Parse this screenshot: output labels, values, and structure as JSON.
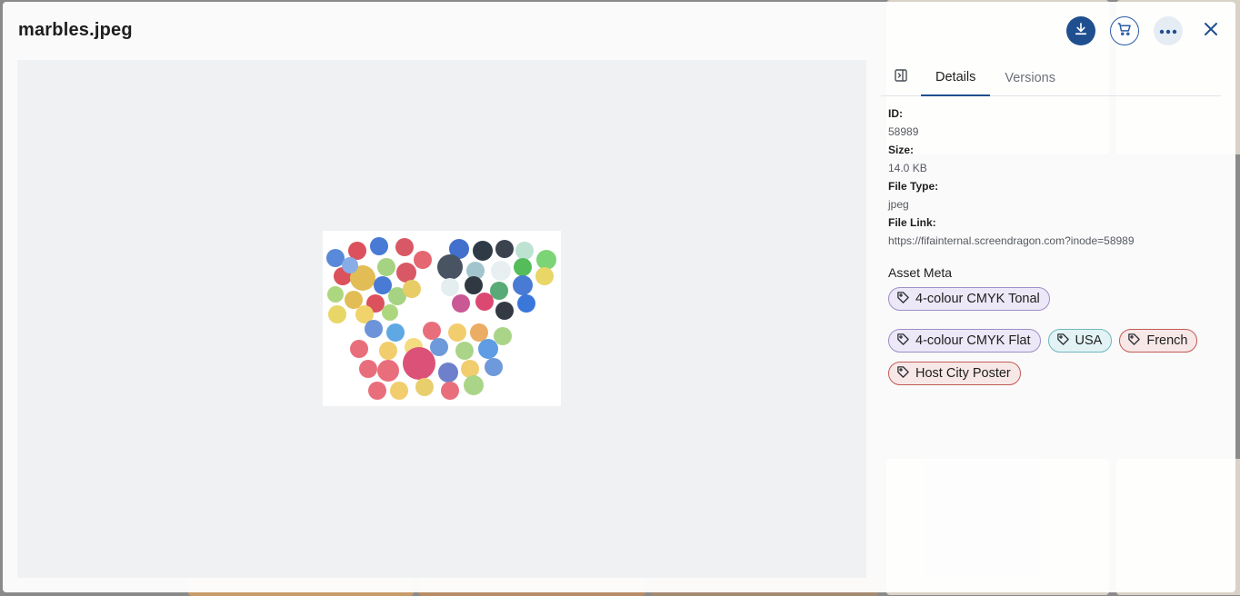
{
  "header": {
    "title": "marbles.jpeg",
    "download_icon": "download-icon",
    "cart_icon": "cart-icon",
    "more_icon": "more-horizontal-icon",
    "close_icon": "close-icon"
  },
  "panel": {
    "collapse_icon": "panel-collapse-icon",
    "tabs": [
      {
        "label": "Details",
        "active": true
      },
      {
        "label": "Versions",
        "active": false
      }
    ],
    "details": {
      "id_label": "ID:",
      "id_value": "58989",
      "size_label": "Size:",
      "size_value": "14.0 KB",
      "type_label": "File Type:",
      "type_value": "jpeg",
      "link_label": "File Link:",
      "link_value": "https://fifainternal.screendragon.com?inode=58989"
    },
    "asset_meta": {
      "title": "Asset Meta",
      "tags": [
        {
          "label": "4-colour CMYK Tonal",
          "color": "purple"
        },
        {
          "label": "4-colour CMYK Flat",
          "color": "purple"
        },
        {
          "label": "USA",
          "color": "teal"
        },
        {
          "label": "French",
          "color": "red"
        },
        {
          "label": "Host City Poster",
          "color": "red"
        }
      ]
    }
  },
  "colors": {
    "accent": "#1f4f8f",
    "tag_purple": "#ece8f7",
    "tag_teal": "#e3f3f5",
    "tag_red": "#f7e8e7"
  }
}
